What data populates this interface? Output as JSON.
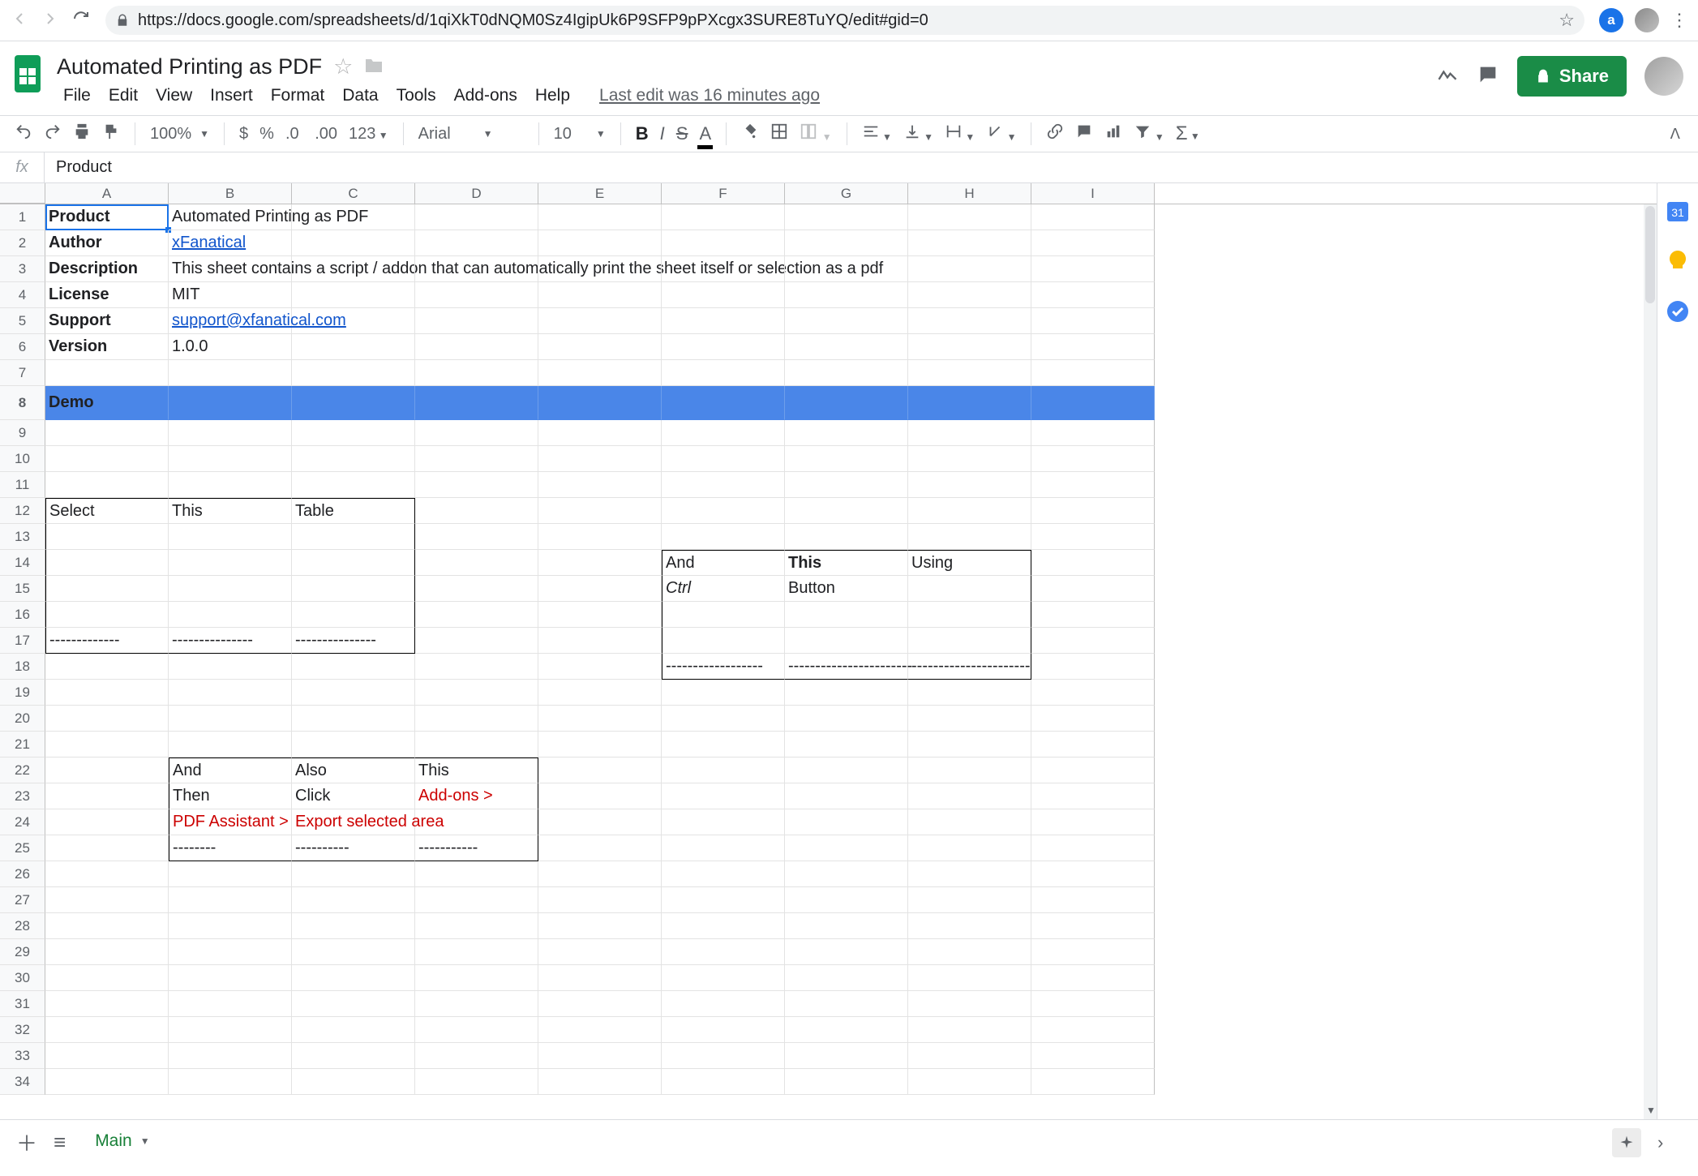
{
  "browser": {
    "url": "https://docs.google.com/spreadsheets/d/1qiXkT0dNQM0Sz4IgipUk6P9SFP9pPXcgx3SURE8TuYQ/edit#gid=0"
  },
  "doc": {
    "title": "Automated Printing as PDF",
    "last_edit": "Last edit was 16 minutes ago",
    "share": "Share"
  },
  "menu": {
    "file": "File",
    "edit": "Edit",
    "view": "View",
    "insert": "Insert",
    "format": "Format",
    "data": "Data",
    "tools": "Tools",
    "addons": "Add-ons",
    "help": "Help"
  },
  "toolbar": {
    "zoom": "100%",
    "font": "Arial",
    "size": "10",
    "fmt123": "123"
  },
  "fx": {
    "value": "Product"
  },
  "columns": [
    "A",
    "B",
    "C",
    "D",
    "E",
    "F",
    "G",
    "H",
    "I"
  ],
  "rows": [
    "1",
    "2",
    "3",
    "4",
    "5",
    "6",
    "7",
    "8",
    "9",
    "10",
    "11",
    "12",
    "13",
    "14",
    "15",
    "16",
    "17",
    "18",
    "19",
    "20",
    "21",
    "22",
    "23",
    "24",
    "25",
    "26",
    "27",
    "28",
    "29",
    "30",
    "31",
    "32",
    "33",
    "34"
  ],
  "cells": {
    "r1": {
      "A": "Product",
      "B": "Automated Printing as PDF"
    },
    "r2": {
      "A": "Author",
      "B": "xFanatical"
    },
    "r3": {
      "A": "Description",
      "B": "This sheet contains a script / addon that can automatically print the sheet itself or selection as a pdf"
    },
    "r4": {
      "A": "License",
      "B": "MIT"
    },
    "r5": {
      "A": "Support",
      "B": "support@xfanatical.com"
    },
    "r6": {
      "A": "Version",
      "B": "1.0.0"
    },
    "r8": {
      "A": "Demo"
    },
    "r12": {
      "A": "Select",
      "B": "This",
      "C": "Table"
    },
    "r14": {
      "F": "And",
      "G": "This",
      "H": "Using"
    },
    "r15": {
      "F": "Ctrl",
      "G": "Button"
    },
    "r17": {
      "A": "-------------",
      "B": "---------------",
      "C": "---------------"
    },
    "r18": {
      "F": "------------------",
      "G": "-----------------------",
      "H": "----------------------"
    },
    "r22": {
      "B": "And",
      "C": "Also",
      "D": "This"
    },
    "r23": {
      "B": "Then",
      "C": "Click",
      "D": "Add-ons >"
    },
    "r24": {
      "B": "PDF Assistant >",
      "C": "Export selected area"
    },
    "r25": {
      "B": "--------",
      "C": "----------",
      "D": "-----------"
    }
  },
  "tab": {
    "name": "Main"
  }
}
